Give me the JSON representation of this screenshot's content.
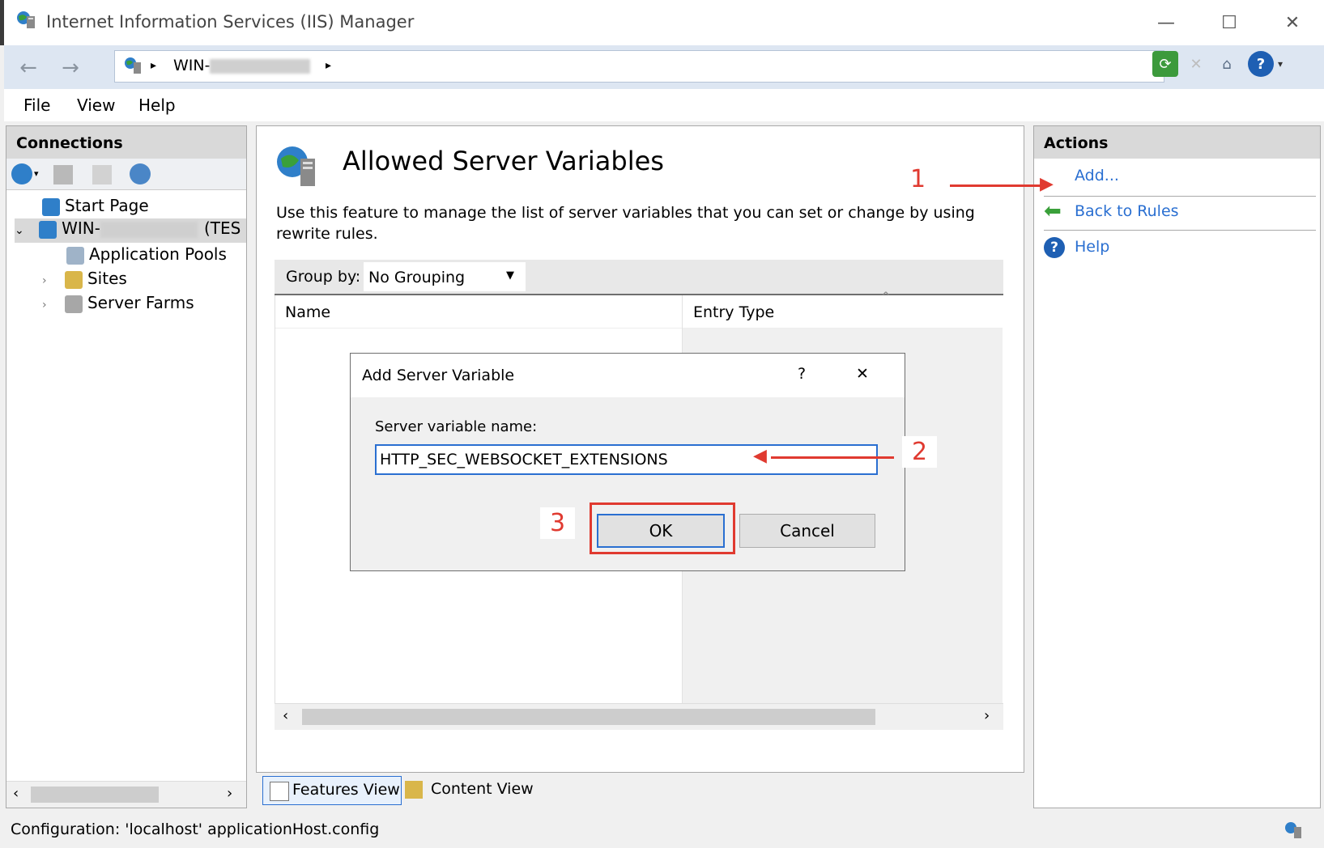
{
  "window": {
    "title": "Internet Information Services (IIS) Manager",
    "minimize": "—",
    "maximize": "☐",
    "close": "✕"
  },
  "address": {
    "server_prefix": "WIN-",
    "sep": "▸"
  },
  "menu": {
    "file": "File",
    "view": "View",
    "help": "Help"
  },
  "connections": {
    "title": "Connections",
    "start_page": "Start Page",
    "server_prefix": "WIN-",
    "server_suffix": "(TES",
    "app_pools": "Application Pools",
    "sites": "Sites",
    "server_farms": "Server Farms"
  },
  "main": {
    "title": "Allowed Server Variables",
    "description": "Use this feature to manage the list of server variables that you can set or change by using rewrite rules.",
    "group_by_label": "Group by:",
    "group_by_value": "No Grouping",
    "col_name": "Name",
    "col_entry_type": "Entry Type"
  },
  "views": {
    "features": "Features View",
    "content": "Content View"
  },
  "actions": {
    "title": "Actions",
    "add": "Add...",
    "back": "Back to Rules",
    "help": "Help"
  },
  "dialog": {
    "title": "Add Server Variable",
    "help_glyph": "?",
    "close_glyph": "✕",
    "field_label": "Server variable name:",
    "field_value": "HTTP_SEC_WEBSOCKET_EXTENSIONS",
    "ok": "OK",
    "cancel": "Cancel"
  },
  "annotations": {
    "step1": "1",
    "step2": "2",
    "step3": "3"
  },
  "status": {
    "text": "Configuration: 'localhost' applicationHost.config"
  },
  "colors": {
    "accent": "#2a6fd1",
    "annotation": "#e03a30",
    "panel_header": "#d9d9d9"
  }
}
